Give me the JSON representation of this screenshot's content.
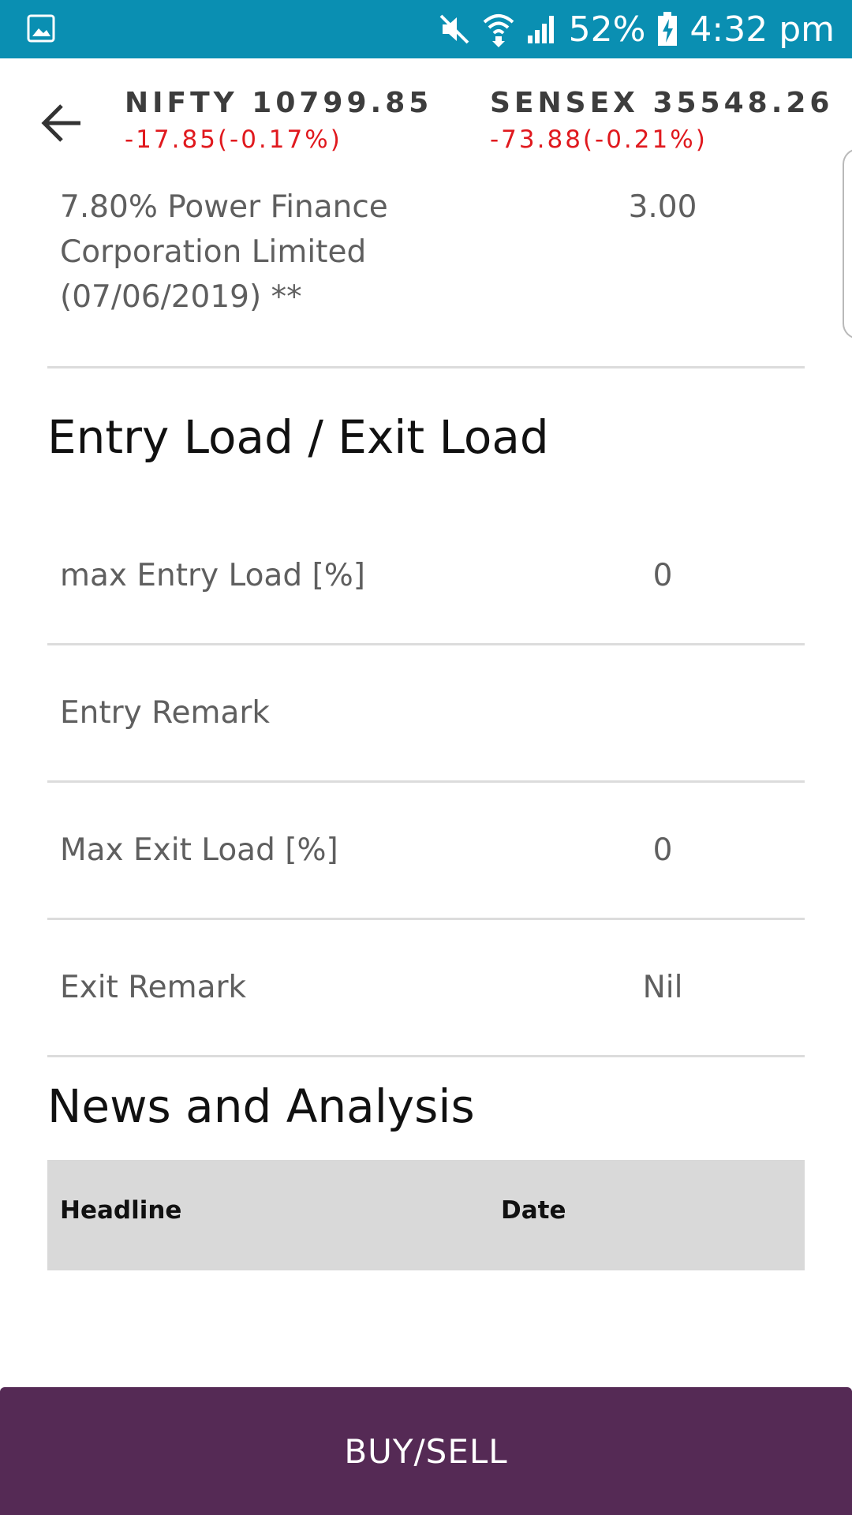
{
  "status_bar": {
    "battery_percent": "52%",
    "time": "4:32 pm",
    "icons": [
      "gallery-icon",
      "mute-icon",
      "wifi-icon",
      "signal-icon",
      "battery-charging-icon"
    ]
  },
  "header": {
    "back_icon": "back-arrow-icon",
    "nifty": {
      "name": "NIFTY 10799.85",
      "change": "-17.85(-0.17%)"
    },
    "sensex": {
      "name": "SENSEX 35548.26",
      "change": "-73.88(-0.21%)"
    }
  },
  "holding": {
    "name": "7.80% Power Finance Corporation Limited (07/06/2019) **",
    "value": "3.00"
  },
  "load_section": {
    "title": "Entry Load / Exit Load",
    "rows": [
      {
        "label": "max Entry Load [%]",
        "value": "0"
      },
      {
        "label": "Entry Remark",
        "value": ""
      },
      {
        "label": "Max Exit Load [%]",
        "value": "0"
      },
      {
        "label": "Exit Remark",
        "value": "Nil"
      }
    ]
  },
  "news_section": {
    "title": "News and Analysis",
    "columns": [
      "Headline",
      "Date"
    ]
  },
  "actions": {
    "buy_sell_label": "BUY/SELL"
  },
  "colors": {
    "status_bar": "#0a8fb2",
    "negative_change": "#e0191e",
    "buy_sell_bg": "#552a55",
    "table_header_bg": "#d9d9d9"
  }
}
